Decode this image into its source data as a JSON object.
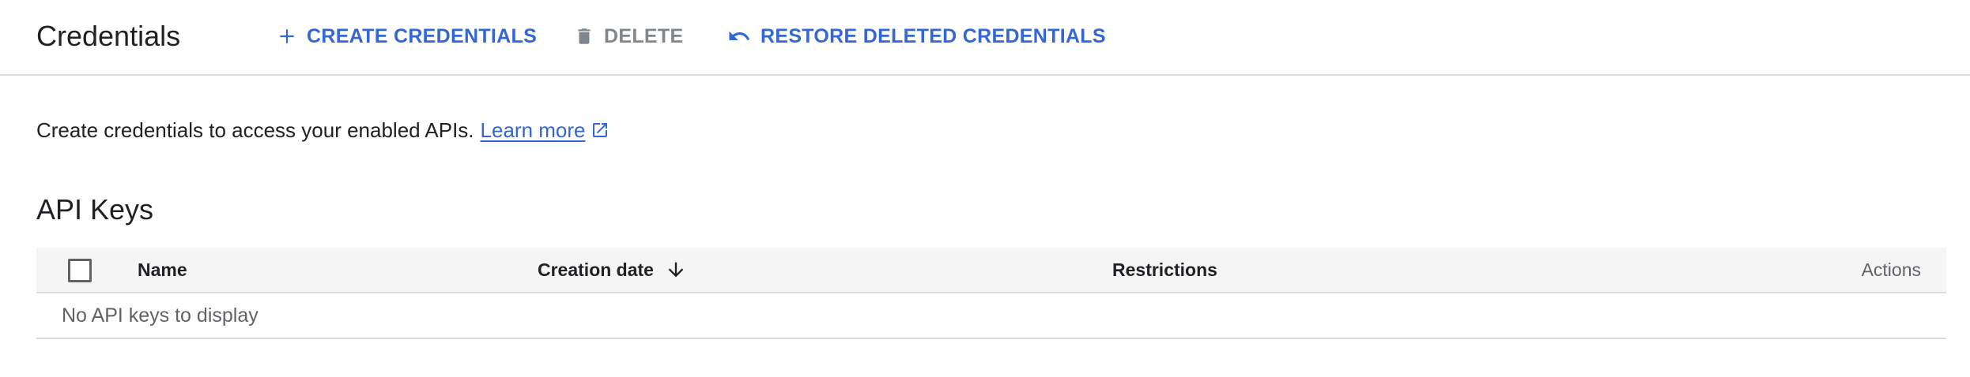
{
  "header": {
    "title": "Credentials",
    "actions": {
      "create_label": "CREATE CREDENTIALS",
      "delete_label": "DELETE",
      "restore_label": "RESTORE DELETED CREDENTIALS"
    }
  },
  "intro": {
    "text": "Create credentials to access your enabled APIs.",
    "link_label": "Learn more"
  },
  "api_keys": {
    "title": "API Keys",
    "columns": {
      "name": "Name",
      "creation_date": "Creation date",
      "restrictions": "Restrictions",
      "actions": "Actions"
    },
    "sort": {
      "column": "creation_date",
      "direction": "descending"
    },
    "empty_message": "No API keys to display"
  },
  "colors": {
    "accent": "#3367d6",
    "disabled": "#80868b",
    "header_bg": "#f5f5f5",
    "divider": "#dadce0"
  },
  "icons": {
    "create": "plus-icon",
    "delete": "trash-icon",
    "restore": "undo-icon",
    "learn_more": "external-link-icon",
    "sort": "arrow-down-icon"
  }
}
